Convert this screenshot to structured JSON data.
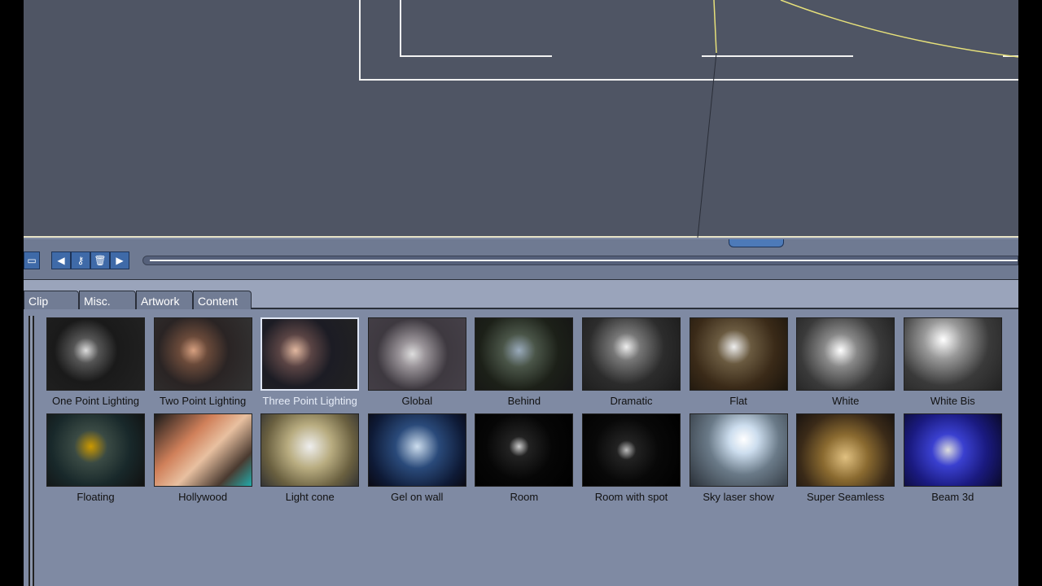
{
  "timeline": {
    "buttons": [
      "record-icon",
      "previous-key-icon",
      "key-icon",
      "delete-key-icon",
      "next-key-icon"
    ]
  },
  "tabs": [
    "Clip",
    "Misc.",
    "Artwork",
    "Content"
  ],
  "library": {
    "selected": "Three Point Lighting",
    "rows": [
      [
        "One Point Lighting",
        "Two Point Lighting",
        "Three Point Lighting",
        "Global",
        "Behind",
        "Dramatic",
        "Flat",
        "White",
        "White Bis"
      ],
      [
        "Floating",
        "Hollywood",
        "Light cone",
        "Gel on wall",
        "Room",
        "Room with spot",
        "Sky laser show",
        "Super Seamless",
        "Beam 3d"
      ]
    ]
  },
  "colors": {
    "viewport": "#4f5564",
    "panel": "#7f8aa3",
    "accent": "#3f6aa8",
    "guide": "#e6e07a"
  }
}
